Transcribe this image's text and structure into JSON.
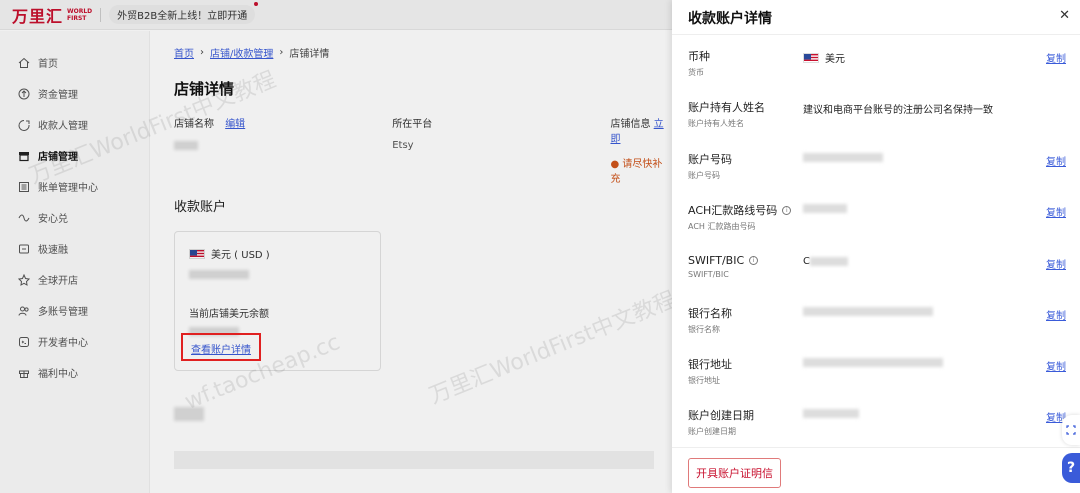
{
  "topbar": {
    "logo_cn": "万里汇",
    "logo_en_line1": "WORLD",
    "logo_en_line2": "FIRST",
    "promo": "外贸B2B全新上线！立即开通"
  },
  "sidebar": {
    "items": [
      {
        "label": "首页",
        "icon": "home-icon"
      },
      {
        "label": "资金管理",
        "icon": "fund-icon"
      },
      {
        "label": "收款人管理",
        "icon": "payee-icon"
      },
      {
        "label": "店铺管理",
        "icon": "store-icon",
        "active": true
      },
      {
        "label": "账单管理中心",
        "icon": "bill-icon"
      },
      {
        "label": "安心兑",
        "icon": "exchange-icon"
      },
      {
        "label": "极速融",
        "icon": "finance-icon"
      },
      {
        "label": "全球开店",
        "icon": "global-icon"
      },
      {
        "label": "多账号管理",
        "icon": "multi-account-icon"
      },
      {
        "label": "开发者中心",
        "icon": "developer-icon"
      },
      {
        "label": "福利中心",
        "icon": "gift-icon"
      }
    ]
  },
  "main": {
    "breadcrumb": [
      "首页",
      "店铺/收款管理",
      "店铺详情"
    ],
    "title": "店铺详情",
    "store_name_label": "店铺名称",
    "edit_label": "编辑",
    "platform_label": "所在平台",
    "platform_value": "Etsy",
    "store_info_label": "店铺信息",
    "store_info_link": "立即",
    "store_info_warn": "请尽快补充",
    "section_title": "收款账户",
    "card": {
      "currency": "美元 ( USD )",
      "balance_label": "当前店铺美元余额",
      "detail_link": "查看账户详情"
    }
  },
  "drawer": {
    "title": "收款账户详情",
    "copy_label": "复制",
    "fields": [
      {
        "label": "币种",
        "sub": "货币",
        "value": "美元",
        "copy": true
      },
      {
        "label": "账户持有人姓名",
        "sub": "账户持有人姓名",
        "value": "建议和电商平台账号的注册公司名保持一致",
        "copy": false
      },
      {
        "label": "账户号码",
        "sub": "账户号码",
        "value": "",
        "copy": true
      },
      {
        "label": "ACH汇款路线号码",
        "sub": "ACH 汇款路由号码",
        "value": "",
        "copy": true,
        "info": true
      },
      {
        "label": "SWIFT/BIC",
        "sub": "SWIFT/BIC",
        "value": "C",
        "copy": true,
        "info": true
      },
      {
        "label": "银行名称",
        "sub": "银行名称",
        "value": "",
        "copy": true
      },
      {
        "label": "银行地址",
        "sub": "银行地址",
        "value": "",
        "copy": true
      },
      {
        "label": "账户创建日期",
        "sub": "账户创建日期",
        "value": "",
        "copy": true
      }
    ],
    "cert_button": "开具账户证明信"
  },
  "watermark": [
    "万里汇WorldFirst中文教程",
    "wf.taocheap.cc"
  ],
  "colors": {
    "brand": "#c8102e",
    "link": "#3a5bd9",
    "highlight_box": "#e02020"
  }
}
